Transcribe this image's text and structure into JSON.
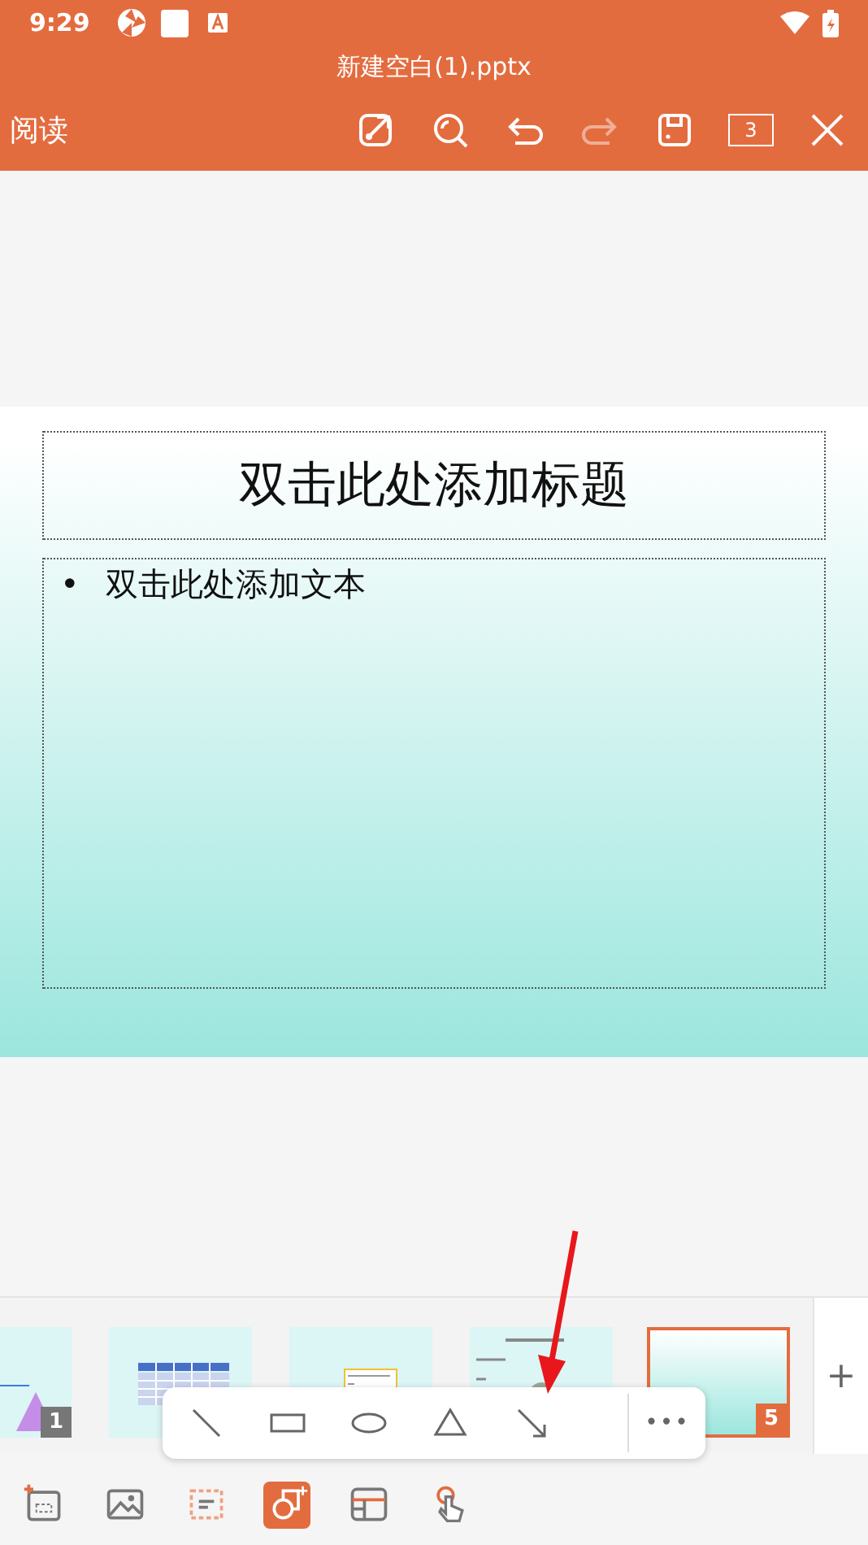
{
  "status_bar": {
    "time": "9:29"
  },
  "window": {
    "title": "新建空白(1).pptx"
  },
  "toolbar": {
    "mode_label": "阅读",
    "page_count": "3",
    "actions": [
      {
        "kind": "share",
        "disabled": false
      },
      {
        "kind": "search",
        "disabled": false
      },
      {
        "kind": "undo",
        "disabled": false
      },
      {
        "kind": "redo",
        "disabled": true
      },
      {
        "kind": "save",
        "disabled": false
      }
    ]
  },
  "slide": {
    "title_placeholder": "双击此处添加标题",
    "bullet": "•",
    "body_placeholder": "双击此处添加文本"
  },
  "thumbnails": [
    {
      "kind": "triangle",
      "number": "1",
      "selected": false
    },
    {
      "kind": "table",
      "selected": false
    },
    {
      "kind": "textbox",
      "selected": false
    },
    {
      "kind": "photo",
      "selected": false
    },
    {
      "kind": "blank",
      "number": "5",
      "selected": true
    }
  ],
  "add_slide": "+",
  "shape_menu": {
    "tools": [
      {
        "kind": "line"
      },
      {
        "kind": "rect"
      },
      {
        "kind": "ellipse"
      },
      {
        "kind": "triangle"
      },
      {
        "kind": "arrow"
      }
    ],
    "more": "•••"
  },
  "bottom_tools": [
    {
      "kind": "new-slide",
      "selected": false
    },
    {
      "kind": "image",
      "selected": false
    },
    {
      "kind": "textbox",
      "selected": false
    },
    {
      "kind": "shape",
      "selected": true
    },
    {
      "kind": "table",
      "selected": false
    },
    {
      "kind": "touch",
      "selected": false
    }
  ]
}
